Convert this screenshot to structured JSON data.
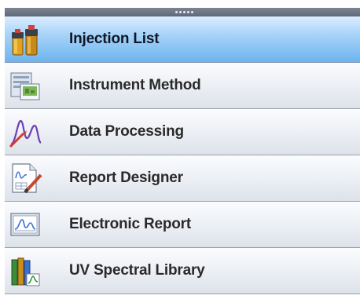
{
  "nav": {
    "items": [
      {
        "label": "Injection List",
        "icon": "vials-icon",
        "selected": true
      },
      {
        "label": "Instrument Method",
        "icon": "instrument-method-icon",
        "selected": false
      },
      {
        "label": "Data Processing",
        "icon": "chromatogram-peak-icon",
        "selected": false
      },
      {
        "label": "Report Designer",
        "icon": "report-designer-icon",
        "selected": false
      },
      {
        "label": "Electronic Report",
        "icon": "electronic-report-icon",
        "selected": false
      },
      {
        "label": "UV Spectral Library",
        "icon": "spectral-library-icon",
        "selected": false
      }
    ]
  },
  "colors": {
    "selected_top": "#dbeeff",
    "selected_bottom": "#6db4ef",
    "item_top": "#fbfcfe",
    "item_bottom": "#dde2ea",
    "header_bar": "#6b7381"
  }
}
